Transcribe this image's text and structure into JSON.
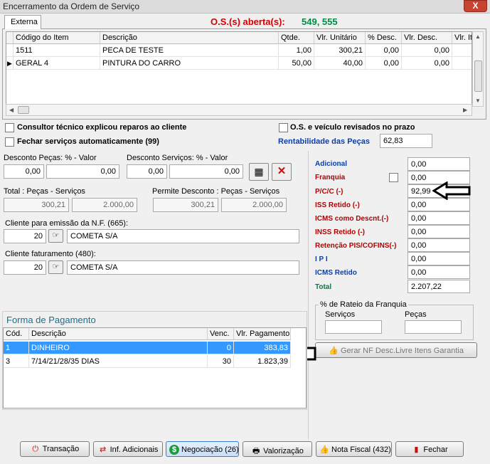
{
  "window": {
    "title": "Encerramento da Ordem de Serviço",
    "close": "X"
  },
  "tab": {
    "label": "Externa"
  },
  "os": {
    "label": "O.S.(s) aberta(s):",
    "numbers": "549, 555"
  },
  "items_table": {
    "headers": [
      "Código do Item",
      "Descrição",
      "Qtde.",
      "Vlr. Unitário",
      "% Desc.",
      "Vlr. Desc.",
      "Vlr. It"
    ],
    "rows": [
      [
        "1511",
        "PECA DE TESTE",
        "1,00",
        "300,21",
        "0,00",
        "0,00",
        ""
      ],
      [
        "GERAL 4",
        "PINTURA DO CARRO",
        "50,00",
        "40,00",
        "0,00",
        "0,00",
        ""
      ]
    ]
  },
  "checks": {
    "consultor": "Consultor técnico explicou reparos ao cliente",
    "fechar": "Fechar serviços automaticamente (99)",
    "revisados": "O.S. e veículo revisados no prazo"
  },
  "rentabilidade": {
    "label": "Rentabilidade das Peças",
    "value": "62,83"
  },
  "descontos": {
    "pecas_label": "Desconto Peças: % - Valor",
    "pecas_pct": "0,00",
    "pecas_val": "0,00",
    "servicos_label": "Desconto Serviços: % - Valor",
    "servicos_pct": "0,00",
    "servicos_val": "0,00"
  },
  "totais": {
    "total_label": "Total : Peças - Serviços",
    "total_pecas": "300,21",
    "total_servicos": "2.000,00",
    "permite_label": "Permite Desconto : Peças - Serviços",
    "permite_pecas": "300,21",
    "permite_servicos": "2.000,00"
  },
  "cliente_nf": {
    "label": "Cliente para emissão da N.F. (665):",
    "code": "20",
    "name": "COMETA S/A"
  },
  "cliente_fat": {
    "label": "Cliente faturamento (480):",
    "code": "20",
    "name": "COMETA S/A"
  },
  "right_panel": {
    "adicional": {
      "label": "Adicional",
      "value": "0,00"
    },
    "franquia": {
      "label": "Franquia",
      "value": "0,00"
    },
    "pcc": {
      "label": "P/C/C (-)",
      "value": "92,99"
    },
    "iss": {
      "label": "ISS Retido (-)",
      "value": "0,00"
    },
    "icms_desc": {
      "label": "ICMS como Descnt.(-)",
      "value": "0,00"
    },
    "inss": {
      "label": "INSS Retido (-)",
      "value": "0,00"
    },
    "pis": {
      "label": "Retenção PIS/COFINS(-)",
      "value": "0,00"
    },
    "ipi": {
      "label": "I P I",
      "value": "0,00"
    },
    "icms_ret": {
      "label": "ICMS Retido",
      "value": "0,00"
    },
    "total": {
      "label": "Total",
      "value": "2.207,22"
    }
  },
  "rateio": {
    "title": "% de Rateio da Franquia",
    "servicos": "Serviços",
    "pecas": "Peças"
  },
  "gerar_nf": "Gerar NF Desc.Livre Itens Garantia",
  "pagamento": {
    "title": "Forma de Pagamento",
    "headers": [
      "Cód.",
      "Descrição",
      "Venc.",
      "Vlr. Pagamento"
    ],
    "rows": [
      [
        "1",
        "DINHEIRO",
        "0",
        "383,83"
      ],
      [
        "3",
        "7/14/21/28/35 DIAS",
        "30",
        "1.823,39"
      ]
    ]
  },
  "buttons": {
    "transacao": "Transação",
    "inf_adicionais": "Inf. Adicionais",
    "negociacao": "Negociação (26)",
    "valorizacao": "Valorização",
    "nota_fiscal": "Nota Fiscal (432)",
    "fechar": "Fechar"
  },
  "colors": {
    "accent_red": "#d40000",
    "accent_green": "#008c45",
    "selection": "#3399ff"
  }
}
